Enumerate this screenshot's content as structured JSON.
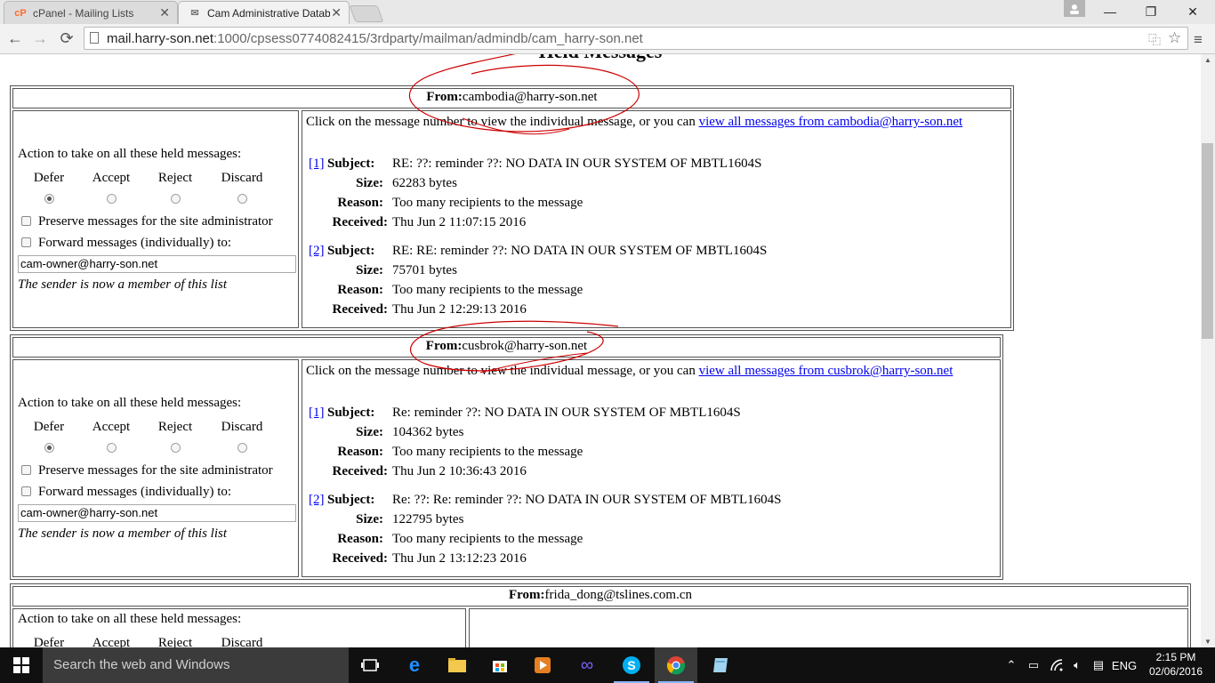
{
  "browser": {
    "tabs": [
      {
        "label": "cPanel - Mailing Lists",
        "icon": "cpanel-icon"
      },
      {
        "label": "Cam Administrative Datab",
        "icon": "mail-icon"
      }
    ],
    "url_host": "mail.harry-son.net",
    "url_path": ":1000/cpsess0774082415/3rdparty/mailman/admindb/cam_harry-son.net"
  },
  "page": {
    "heading": "Held Messages",
    "groups": [
      {
        "from_label": "From:",
        "from": "cambodia@harry-son.net",
        "action_title": "Action to take on all these held messages:",
        "actions": [
          "Defer",
          "Accept",
          "Reject",
          "Discard"
        ],
        "preserve_label": "Preserve messages for the site administrator",
        "forward_label": "Forward messages (individually) to:",
        "forward_value": "cam-owner@harry-son.net",
        "member_note": "The sender is now a member of this list",
        "intro": "Click on the message number to view the individual message, or you can ",
        "view_all_link": "view all messages from cambodia@harry-son.net",
        "messages": [
          {
            "num": "[1]",
            "subject": "RE: ??: reminder ??: NO DATA IN OUR SYSTEM OF MBTL1604S",
            "size": "62283 bytes",
            "reason": "Too many recipients to the message",
            "received": "Thu Jun 2 11:07:15 2016"
          },
          {
            "num": "[2]",
            "subject": "RE: RE: reminder ??: NO DATA IN OUR SYSTEM OF MBTL1604S",
            "size": "75701 bytes",
            "reason": "Too many recipients to the message",
            "received": "Thu Jun 2 12:29:13 2016"
          }
        ]
      },
      {
        "from_label": "From:",
        "from": "cusbrok@harry-son.net",
        "action_title": "Action to take on all these held messages:",
        "actions": [
          "Defer",
          "Accept",
          "Reject",
          "Discard"
        ],
        "preserve_label": "Preserve messages for the site administrator",
        "forward_label": "Forward messages (individually) to:",
        "forward_value": "cam-owner@harry-son.net",
        "member_note": "The sender is now a member of this list",
        "intro": "Click on the message number to view the individual message, or you can ",
        "view_all_link": "view all messages from cusbrok@harry-son.net",
        "messages": [
          {
            "num": "[1]",
            "subject": "Re: reminder ??: NO DATA IN OUR SYSTEM OF MBTL1604S",
            "size": "104362 bytes",
            "reason": "Too many recipients to the message",
            "received": "Thu Jun 2 10:36:43 2016"
          },
          {
            "num": "[2]",
            "subject": "Re: ??: Re: reminder ??: NO DATA IN OUR SYSTEM OF MBTL1604S",
            "size": "122795 bytes",
            "reason": "Too many recipients to the message",
            "received": "Thu Jun 2 13:12:23 2016"
          }
        ]
      },
      {
        "from_label": "From:",
        "from": "frida_dong@tslines.com.cn",
        "action_title": "Action to take on all these held messages:",
        "actions": [
          "Defer",
          "Accept",
          "Reject",
          "Discard"
        ]
      }
    ],
    "labels": {
      "subject": "Subject:",
      "size": "Size:",
      "reason": "Reason:",
      "received": "Received:"
    }
  },
  "taskbar": {
    "search_placeholder": "Search the web and Windows",
    "language": "ENG",
    "time": "2:15 PM",
    "date": "02/06/2016"
  },
  "colors": {
    "link": "#0000ee",
    "annotation": "#cc0000",
    "taskbar": "#101010"
  }
}
